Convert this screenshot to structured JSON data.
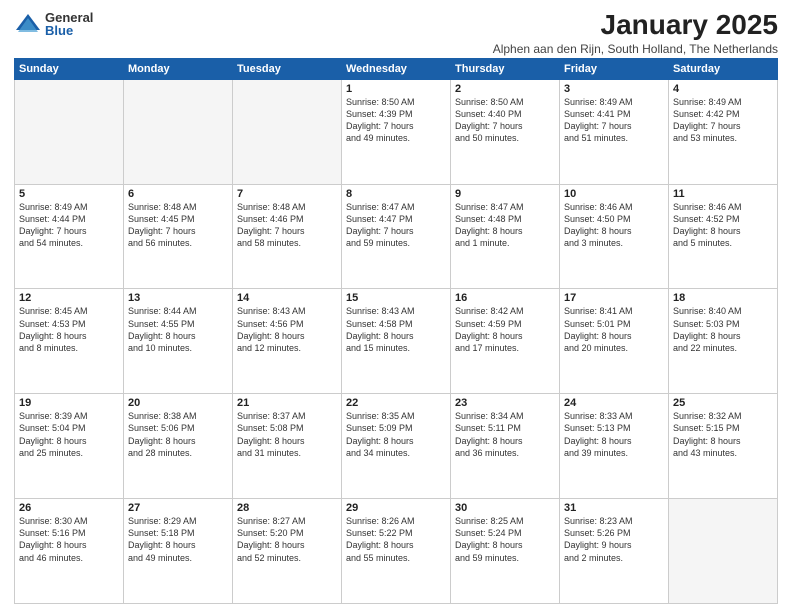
{
  "logo": {
    "general": "General",
    "blue": "Blue"
  },
  "title": "January 2025",
  "subtitle": "Alphen aan den Rijn, South Holland, The Netherlands",
  "days_of_week": [
    "Sunday",
    "Monday",
    "Tuesday",
    "Wednesday",
    "Thursday",
    "Friday",
    "Saturday"
  ],
  "weeks": [
    [
      {
        "day": "",
        "info": ""
      },
      {
        "day": "",
        "info": ""
      },
      {
        "day": "",
        "info": ""
      },
      {
        "day": "1",
        "info": "Sunrise: 8:50 AM\nSunset: 4:39 PM\nDaylight: 7 hours\nand 49 minutes."
      },
      {
        "day": "2",
        "info": "Sunrise: 8:50 AM\nSunset: 4:40 PM\nDaylight: 7 hours\nand 50 minutes."
      },
      {
        "day": "3",
        "info": "Sunrise: 8:49 AM\nSunset: 4:41 PM\nDaylight: 7 hours\nand 51 minutes."
      },
      {
        "day": "4",
        "info": "Sunrise: 8:49 AM\nSunset: 4:42 PM\nDaylight: 7 hours\nand 53 minutes."
      }
    ],
    [
      {
        "day": "5",
        "info": "Sunrise: 8:49 AM\nSunset: 4:44 PM\nDaylight: 7 hours\nand 54 minutes."
      },
      {
        "day": "6",
        "info": "Sunrise: 8:48 AM\nSunset: 4:45 PM\nDaylight: 7 hours\nand 56 minutes."
      },
      {
        "day": "7",
        "info": "Sunrise: 8:48 AM\nSunset: 4:46 PM\nDaylight: 7 hours\nand 58 minutes."
      },
      {
        "day": "8",
        "info": "Sunrise: 8:47 AM\nSunset: 4:47 PM\nDaylight: 7 hours\nand 59 minutes."
      },
      {
        "day": "9",
        "info": "Sunrise: 8:47 AM\nSunset: 4:48 PM\nDaylight: 8 hours\nand 1 minute."
      },
      {
        "day": "10",
        "info": "Sunrise: 8:46 AM\nSunset: 4:50 PM\nDaylight: 8 hours\nand 3 minutes."
      },
      {
        "day": "11",
        "info": "Sunrise: 8:46 AM\nSunset: 4:52 PM\nDaylight: 8 hours\nand 5 minutes."
      }
    ],
    [
      {
        "day": "12",
        "info": "Sunrise: 8:45 AM\nSunset: 4:53 PM\nDaylight: 8 hours\nand 8 minutes."
      },
      {
        "day": "13",
        "info": "Sunrise: 8:44 AM\nSunset: 4:55 PM\nDaylight: 8 hours\nand 10 minutes."
      },
      {
        "day": "14",
        "info": "Sunrise: 8:43 AM\nSunset: 4:56 PM\nDaylight: 8 hours\nand 12 minutes."
      },
      {
        "day": "15",
        "info": "Sunrise: 8:43 AM\nSunset: 4:58 PM\nDaylight: 8 hours\nand 15 minutes."
      },
      {
        "day": "16",
        "info": "Sunrise: 8:42 AM\nSunset: 4:59 PM\nDaylight: 8 hours\nand 17 minutes."
      },
      {
        "day": "17",
        "info": "Sunrise: 8:41 AM\nSunset: 5:01 PM\nDaylight: 8 hours\nand 20 minutes."
      },
      {
        "day": "18",
        "info": "Sunrise: 8:40 AM\nSunset: 5:03 PM\nDaylight: 8 hours\nand 22 minutes."
      }
    ],
    [
      {
        "day": "19",
        "info": "Sunrise: 8:39 AM\nSunset: 5:04 PM\nDaylight: 8 hours\nand 25 minutes."
      },
      {
        "day": "20",
        "info": "Sunrise: 8:38 AM\nSunset: 5:06 PM\nDaylight: 8 hours\nand 28 minutes."
      },
      {
        "day": "21",
        "info": "Sunrise: 8:37 AM\nSunset: 5:08 PM\nDaylight: 8 hours\nand 31 minutes."
      },
      {
        "day": "22",
        "info": "Sunrise: 8:35 AM\nSunset: 5:09 PM\nDaylight: 8 hours\nand 34 minutes."
      },
      {
        "day": "23",
        "info": "Sunrise: 8:34 AM\nSunset: 5:11 PM\nDaylight: 8 hours\nand 36 minutes."
      },
      {
        "day": "24",
        "info": "Sunrise: 8:33 AM\nSunset: 5:13 PM\nDaylight: 8 hours\nand 39 minutes."
      },
      {
        "day": "25",
        "info": "Sunrise: 8:32 AM\nSunset: 5:15 PM\nDaylight: 8 hours\nand 43 minutes."
      }
    ],
    [
      {
        "day": "26",
        "info": "Sunrise: 8:30 AM\nSunset: 5:16 PM\nDaylight: 8 hours\nand 46 minutes."
      },
      {
        "day": "27",
        "info": "Sunrise: 8:29 AM\nSunset: 5:18 PM\nDaylight: 8 hours\nand 49 minutes."
      },
      {
        "day": "28",
        "info": "Sunrise: 8:27 AM\nSunset: 5:20 PM\nDaylight: 8 hours\nand 52 minutes."
      },
      {
        "day": "29",
        "info": "Sunrise: 8:26 AM\nSunset: 5:22 PM\nDaylight: 8 hours\nand 55 minutes."
      },
      {
        "day": "30",
        "info": "Sunrise: 8:25 AM\nSunset: 5:24 PM\nDaylight: 8 hours\nand 59 minutes."
      },
      {
        "day": "31",
        "info": "Sunrise: 8:23 AM\nSunset: 5:26 PM\nDaylight: 9 hours\nand 2 minutes."
      },
      {
        "day": "",
        "info": ""
      }
    ]
  ]
}
